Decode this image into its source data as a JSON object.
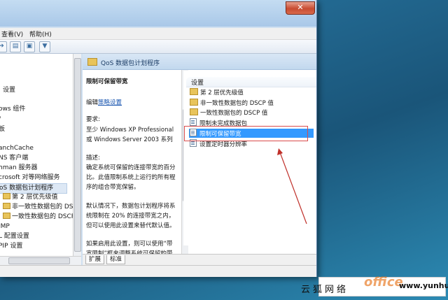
{
  "menu": {
    "view": "查看(V)",
    "help": "帮助(H)"
  },
  "tree": {
    "items": [
      {
        "label": "设置"
      },
      {
        "label": "ows 组件"
      },
      {
        "label": "/"
      },
      {
        "label": "板"
      },
      {
        "label": "anchCache"
      },
      {
        "label": "NS 客户端"
      },
      {
        "label": "hman 服务器"
      },
      {
        "label": "crosoft 对等网络服务"
      },
      {
        "label": "oS 数据包计划程序"
      },
      {
        "label": "第 2 层优先级值"
      },
      {
        "label": "非一致性数据包的 DSCP 值"
      },
      {
        "label": "一致性数据包的 DSCP 值"
      },
      {
        "label": "IMP"
      },
      {
        "label": "L 配置设置"
      },
      {
        "label": "PIP 设置"
      }
    ]
  },
  "banner": {
    "title": "QoS 数据包计划程序"
  },
  "description": {
    "policy_name": "限制可保留带宽",
    "edit_prefix": "编辑",
    "edit_link": "策略设置",
    "requirements_label": "要求:",
    "requirements_line1": "至少 Windows XP Professional",
    "requirements_line2": "或 Windows Server 2003 系列",
    "desc_label": "描述:",
    "desc_line1": "确定系统可保留的连接带宽的百分",
    "desc_line2": "比。此值限制系统上运行的所有程",
    "desc_line3": "序的组合带宽保留。",
    "desc_line4": "默认情况下，数据包计划程序将系",
    "desc_line5": "统限制在 20% 的连接带宽之内，",
    "desc_line6": "但可以使用此设置来替代默认值。",
    "desc_line7": "如果启用此设置，则可以使用“带",
    "desc_line8": "宽限制”框来调整系统可保留的带"
  },
  "settings": {
    "header": "设置",
    "items": [
      {
        "label": "第 2 层优先级值",
        "icon": "folder-icon"
      },
      {
        "label": "非一致性数据包的 DSCP 值",
        "icon": "folder-icon"
      },
      {
        "label": "一致性数据包的 DSCP 值",
        "icon": "folder-icon"
      },
      {
        "label": "限制未完成数据包",
        "icon": "policy-icon"
      },
      {
        "label": "限制可保留带宽",
        "icon": "policy-icon",
        "selected": true
      },
      {
        "label": "设置定时器分辨率",
        "icon": "policy-icon"
      }
    ]
  },
  "tabs": {
    "extended": "扩展",
    "standard": "标准"
  },
  "watermark": {
    "cn": "云狐网络",
    "url": "www.yunhu.net"
  },
  "colors": {
    "selection": "#3399ff",
    "annotation": "#d94c4c",
    "close": "#c84b31"
  }
}
